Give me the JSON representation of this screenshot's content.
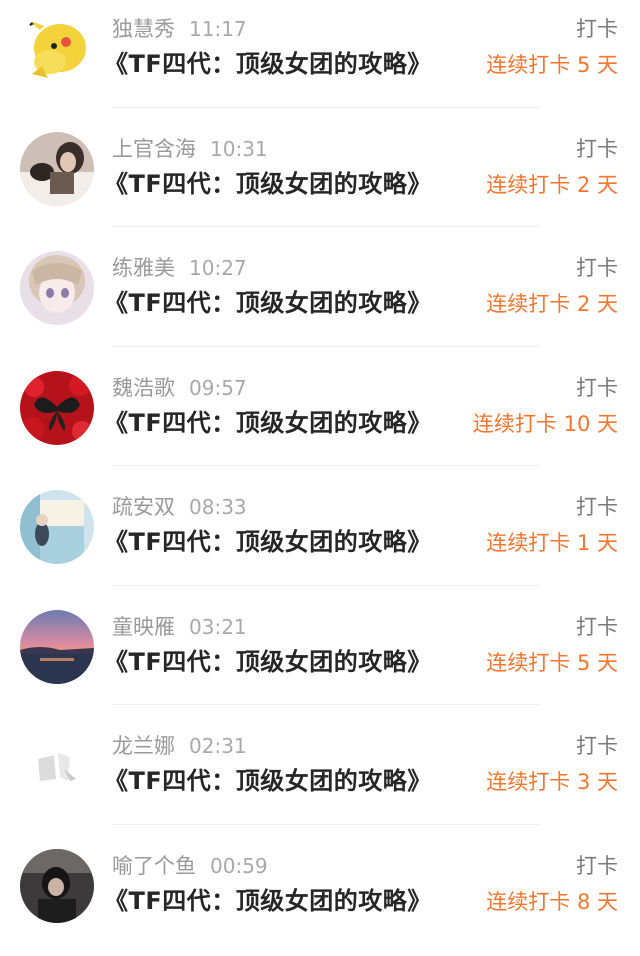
{
  "feed": {
    "items": [
      {
        "name": "独慧秀",
        "time": "11:17",
        "book": "《TF四代：顶级女团的攻略》",
        "action": "打卡",
        "streak": "连续打卡 5 天",
        "avatar_icon": "cartoon-character-avatar"
      },
      {
        "name": "上官含海",
        "time": "10:31",
        "book": "《TF四代：顶级女团的攻略》",
        "action": "打卡",
        "streak": "连续打卡 2 天",
        "avatar_icon": "photo-avatar"
      },
      {
        "name": "练雅美",
        "time": "10:27",
        "book": "《TF四代：顶级女团的攻略》",
        "action": "打卡",
        "streak": "连续打卡 2 天",
        "avatar_icon": "anime-girl-avatar"
      },
      {
        "name": "魏浩歌",
        "time": "09:57",
        "book": "《TF四代：顶级女团的攻略》",
        "action": "打卡",
        "streak": "连续打卡 10 天",
        "avatar_icon": "butterfly-flowers-avatar"
      },
      {
        "name": "疏安双",
        "time": "08:33",
        "book": "《TF四代：顶级女团的攻略》",
        "action": "打卡",
        "streak": "连续打卡 1 天",
        "avatar_icon": "room-photo-avatar"
      },
      {
        "name": "童映雁",
        "time": "03:21",
        "book": "《TF四代：顶级女团的攻略》",
        "action": "打卡",
        "streak": "连续打卡 5 天",
        "avatar_icon": "sunset-sea-avatar"
      },
      {
        "name": "龙兰娜",
        "time": "02:31",
        "book": "《TF四代：顶级女团的攻略》",
        "action": "打卡",
        "streak": "连续打卡 3 天",
        "avatar_icon": "light-abstract-avatar"
      },
      {
        "name": "喻了个鱼",
        "time": "00:59",
        "book": "《TF四代：顶级女团的攻略》",
        "action": "打卡",
        "streak": "连续打卡 8 天",
        "avatar_icon": "dark-portrait-avatar"
      }
    ]
  },
  "colors": {
    "name": "#9a9a9a",
    "time": "#a9a9a9",
    "book_title": "#262626",
    "action": "#7a7a7a",
    "streak_accent": "#f5762e",
    "divider": "#f0f0f0"
  }
}
